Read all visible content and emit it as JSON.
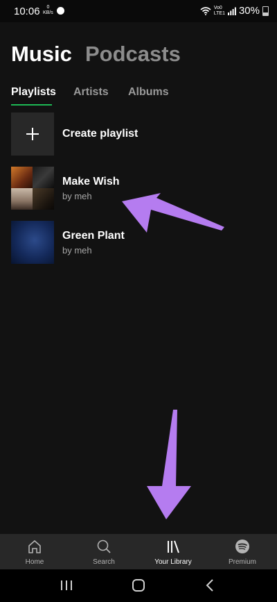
{
  "status_bar": {
    "time": "10:06",
    "data_speed_value": "0",
    "data_speed_unit": "KB/s",
    "volte_line1": "Vo0",
    "volte_line2": "LTE1",
    "battery": "30%"
  },
  "header": {
    "tabs": [
      {
        "label": "Music",
        "active": true
      },
      {
        "label": "Podcasts",
        "active": false
      }
    ]
  },
  "subtabs": [
    {
      "label": "Playlists",
      "active": true
    },
    {
      "label": "Artists",
      "active": false
    },
    {
      "label": "Albums",
      "active": false
    }
  ],
  "create_playlist": {
    "label": "Create playlist",
    "icon": "plus-icon"
  },
  "playlists": [
    {
      "title": "Make Wish",
      "subtitle": "by meh"
    },
    {
      "title": "Green Plant",
      "subtitle": "by meh"
    }
  ],
  "annotation_color": "#b57cf0",
  "bottom_nav": [
    {
      "label": "Home",
      "icon": "home-icon",
      "active": false
    },
    {
      "label": "Search",
      "icon": "search-icon",
      "active": false
    },
    {
      "label": "Your Library",
      "icon": "library-icon",
      "active": true
    },
    {
      "label": "Premium",
      "icon": "spotify-icon",
      "active": false
    }
  ],
  "system_nav": [
    "recents-icon",
    "home-button-icon",
    "back-icon"
  ]
}
